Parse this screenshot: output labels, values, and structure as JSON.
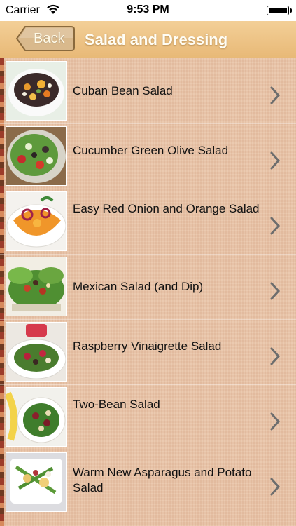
{
  "status_bar": {
    "carrier": "Carrier",
    "time": "9:53 PM"
  },
  "nav": {
    "back_label": "Back",
    "title": "Salad and Dressing"
  },
  "items": [
    {
      "label": "Cuban Bean Salad",
      "thumb": "cuban-bean-salad-photo"
    },
    {
      "label": "Cucumber Green Olive Salad",
      "thumb": "cucumber-olive-salad-photo"
    },
    {
      "label": "Easy Red Onion and Orange Salad",
      "thumb": "red-onion-orange-salad-photo"
    },
    {
      "label": "Mexican Salad (and Dip)",
      "thumb": "mexican-salad-photo"
    },
    {
      "label": "Raspberry Vinaigrette Salad",
      "thumb": "raspberry-vinaigrette-salad-photo"
    },
    {
      "label": "Two-Bean Salad",
      "thumb": "two-bean-salad-photo"
    },
    {
      "label": "Warm New Asparagus and Potato Salad",
      "thumb": "asparagus-potato-salad-photo"
    }
  ],
  "colors": {
    "nav_top": "#f3cf97",
    "nav_bottom": "#e8b977",
    "list_bg": "#e9c4a8",
    "chevron": "#6d6d6d"
  }
}
